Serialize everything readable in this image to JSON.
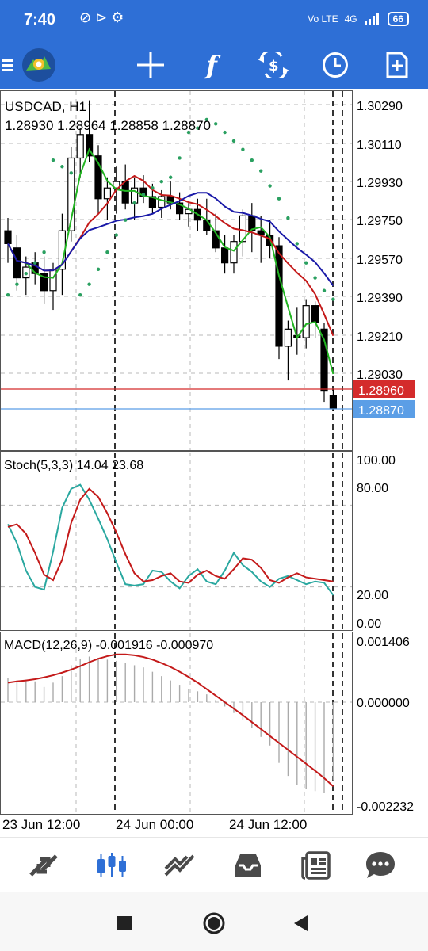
{
  "status_bar": {
    "time": "7:40",
    "network": "4G",
    "volte": "Vo LTE",
    "battery": "66"
  },
  "toolbar": {
    "menu_icon": "menu-icon",
    "logo_icon": "metatrader-logo-icon",
    "crosshair_icon": "crosshair-icon",
    "indicators_icon": "function-icon",
    "symbol_icon": "symbol-change-icon",
    "timeframe_icon": "clock-icon",
    "new_order_icon": "new-order-icon"
  },
  "chart": {
    "symbol": "USDCAD, H1",
    "ohlc": "1.28930 1.28964 1.28858 1.28870",
    "price_axis": [
      "1.30290",
      "1.30110",
      "1.29930",
      "1.29750",
      "1.29570",
      "1.29390",
      "1.29210",
      "1.29030"
    ],
    "ask_price": "1.28960",
    "bid_price": "1.28870",
    "ask_color": "#d42b2b",
    "bid_color": "#5b9ee6",
    "stoch_label": "Stoch(5,3,3) 14.04 23.68",
    "stoch_axis": [
      "100.00",
      "80.00",
      "20.00",
      "0.00"
    ],
    "macd_label": "MACD(12,26,9) -0.001916 -0.000970",
    "macd_axis": [
      "0.001406",
      "0.000000",
      "-0.002232"
    ],
    "time_axis": [
      "23 Jun 12:00",
      "24 Jun 00:00",
      "24 Jun 12:00"
    ]
  },
  "chart_data": [
    {
      "type": "candlestick",
      "price_range": [
        1.2885,
        1.3039
      ],
      "candles": [
        [
          1.297,
          1.2976,
          1.2955,
          1.2964
        ],
        [
          1.2962,
          1.2968,
          1.2942,
          1.2948
        ],
        [
          1.2948,
          1.2958,
          1.294,
          1.2953
        ],
        [
          1.2955,
          1.296,
          1.2945,
          1.295
        ],
        [
          1.295,
          1.2958,
          1.2936,
          1.2942
        ],
        [
          1.2942,
          1.2955,
          1.2933,
          1.2952
        ],
        [
          1.2952,
          1.2978,
          1.294,
          1.297
        ],
        [
          1.297,
          1.3009,
          1.2965,
          1.3004
        ],
        [
          1.3004,
          1.3018,
          1.2995,
          1.3015
        ],
        [
          1.3015,
          1.3031,
          1.3002,
          1.3005
        ],
        [
          1.3005,
          1.301,
          1.2978,
          1.2985
        ],
        [
          1.2985,
          1.2995,
          1.2975,
          1.299
        ],
        [
          1.299,
          1.3,
          1.2978,
          1.2993
        ],
        [
          1.2993,
          1.3001,
          1.298,
          1.2983
        ],
        [
          1.2983,
          1.2995,
          1.2975,
          1.299
        ],
        [
          1.299,
          1.2996,
          1.2983,
          1.2986
        ],
        [
          1.2986,
          1.2992,
          1.2978,
          1.2981
        ],
        [
          1.2981,
          1.2989,
          1.2976,
          1.2986
        ],
        [
          1.2986,
          1.2993,
          1.298,
          1.2983
        ],
        [
          1.2983,
          1.2988,
          1.2975,
          1.2978
        ],
        [
          1.2978,
          1.2983,
          1.2972,
          1.298
        ],
        [
          1.298,
          1.2985,
          1.297,
          1.2975
        ],
        [
          1.2975,
          1.2985,
          1.2968,
          1.297
        ],
        [
          1.297,
          1.2978,
          1.296,
          1.2962
        ],
        [
          1.2962,
          1.2968,
          1.295,
          1.2955
        ],
        [
          1.2955,
          1.2968,
          1.295,
          1.2965
        ],
        [
          1.2965,
          1.298,
          1.2958,
          1.2977
        ],
        [
          1.2977,
          1.2983,
          1.296,
          1.297
        ],
        [
          1.297,
          1.2977,
          1.2955,
          1.2968
        ],
        [
          1.2968,
          1.2975,
          1.2957,
          1.2963
        ],
        [
          1.2963,
          1.2967,
          1.291,
          1.2916
        ],
        [
          1.2916,
          1.2928,
          1.29,
          1.2924
        ],
        [
          1.2921,
          1.2934,
          1.2912,
          1.292
        ],
        [
          1.292,
          1.2938,
          1.2915,
          1.2935
        ],
        [
          1.2935,
          1.2937,
          1.292,
          1.2927
        ],
        [
          1.2924,
          1.2927,
          1.289,
          1.2895
        ],
        [
          1.2893,
          1.2896,
          1.2886,
          1.2887
        ]
      ],
      "parabolic_sar": [
        1.294,
        1.2945,
        1.295,
        1.2955,
        1.296,
        1.3003,
        1.3,
        1.2997,
        1.294,
        1.2945,
        1.2952,
        1.296,
        1.2968,
        1.2975,
        1.2983,
        1.2987,
        1.299,
        1.2993,
        1.2995,
        1.3004,
        1.3016,
        1.3018,
        1.3022,
        1.302,
        1.3016,
        1.3012,
        1.3008,
        1.3003,
        1.2998,
        1.2991,
        1.2985,
        1.2976,
        1.2964,
        1.2955,
        1.2948,
        1.2942,
        1.2938
      ]
    },
    {
      "type": "line",
      "name": "Stoch(5,3,3)",
      "ylim": [
        0,
        100
      ],
      "series": [
        {
          "values": [
            66,
            52,
            32,
            20,
            18,
            46,
            78,
            92,
            95,
            84,
            70,
            55,
            38,
            22,
            21,
            22,
            32,
            31,
            24,
            19,
            28,
            33,
            24,
            22,
            32,
            45,
            36,
            31,
            24,
            20,
            26,
            28,
            25,
            22,
            24,
            23,
            14
          ]
        },
        {
          "values": [
            64,
            66,
            59,
            45,
            29,
            25,
            40,
            67,
            84,
            92,
            86,
            74,
            60,
            44,
            30,
            24,
            25,
            28,
            30,
            24,
            23,
            29,
            32,
            28,
            26,
            33,
            41,
            40,
            34,
            25,
            23,
            27,
            30,
            27,
            26,
            25,
            24
          ]
        }
      ]
    },
    {
      "type": "bar",
      "name": "MACD(12,26,9)",
      "ylim": [
        -0.002232,
        0.001406
      ],
      "histogram": [
        0.00055,
        0.0005,
        0.00052,
        0.00048,
        0.00035,
        0.00045,
        0.0006,
        0.00085,
        0.001,
        0.00105,
        0.00102,
        0.00098,
        0.00095,
        0.0009,
        0.00085,
        0.0008,
        0.0007,
        0.0006,
        0.0005,
        0.0004,
        0.0003,
        0.00025,
        0.00018,
        5e-05,
        -0.0001,
        -0.00025,
        -0.0004,
        -0.0006,
        -0.0008,
        -0.001,
        -0.0014,
        -0.0017,
        -0.0019,
        -0.002,
        -0.00205,
        -0.0021,
        -0.0018
      ],
      "signal": [
        0.00045,
        0.00048,
        0.0005,
        0.00053,
        0.00057,
        0.00062,
        0.00068,
        0.00075,
        0.00083,
        0.00092,
        0.001,
        0.00106,
        0.0011,
        0.0011,
        0.00108,
        0.00104,
        0.00098,
        0.0009,
        0.00081,
        0.0007,
        0.00058,
        0.00045,
        0.0003,
        0.00015,
        0.0,
        -0.00015,
        -0.0003,
        -0.00046,
        -0.00062,
        -0.00078,
        -0.00094,
        -0.0011,
        -0.00126,
        -0.00142,
        -0.00158,
        -0.00175,
        -0.00194
      ]
    }
  ],
  "bottom_nav": {
    "items": [
      "quotes-icon",
      "chart-icon",
      "trade-icon",
      "history-icon",
      "news-icon",
      "chat-icon"
    ]
  },
  "system_nav": {
    "items": [
      "recents-icon",
      "home-icon",
      "back-icon"
    ]
  }
}
